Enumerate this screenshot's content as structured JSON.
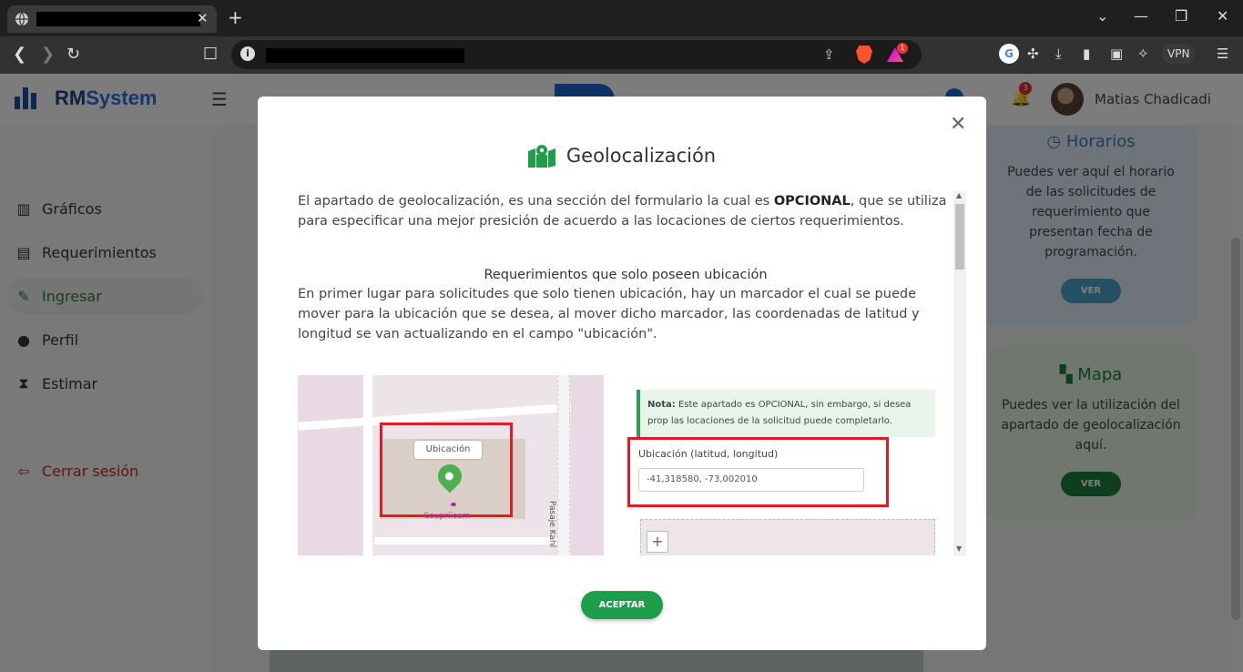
{
  "browser": {
    "tab_close": "✕",
    "new_tab": "+",
    "vpn_label": "VPN",
    "rewards_count": "1"
  },
  "app": {
    "brand_prefix": "RM",
    "brand_suffix": "System",
    "user_name": "Matias Chadicadi",
    "notifications_count": "3",
    "sidebar": [
      {
        "label": "Gráficos",
        "icon": "chart-icon"
      },
      {
        "label": "Requerimientos",
        "icon": "clipboard-icon"
      },
      {
        "label": "Ingresar",
        "icon": "pencil-icon"
      },
      {
        "label": "Perfil",
        "icon": "user-icon"
      },
      {
        "label": "Estimar",
        "icon": "hourglass-icon"
      }
    ],
    "logout_label": "Cerrar sesión",
    "cards": {
      "horarios": {
        "title": "Horarios",
        "text": "Puedes ver aquí el horario de las solicitudes de requerimiento que presentan fecha de programación.",
        "button": "VER",
        "color": "#4a9fc6"
      },
      "mapa": {
        "title": "Mapa",
        "text": "Puedes ver la utilización del apartado de geolocalización aquí.",
        "button": "VER",
        "color": "#1b7d3a"
      }
    }
  },
  "modal": {
    "title": "Geolocalización",
    "intro_before": "El apartado de geolocalización, es una sección del formulario la cual es ",
    "intro_bold": "OPCIONAL",
    "intro_after": ", que se utiliza para especificar una mejor presición de acuerdo a las locaciones de ciertos requerimientos.",
    "section_title": "Requerimientos que solo poseen ubicación",
    "section_text": "En primer lugar para solicitudes que solo tienen ubicación, hay un marcador el cual se puede mover para la ubicación que se desea, al mover dicho marcador, las coordenadas de latitud y longitud se van actualizando en el campo \"ubicación\".",
    "figure": {
      "marker_tag": "Ubicación",
      "street": "Pasaje Kahl",
      "poi": "Coupriicem",
      "note_bold": "Nota:",
      "note_text": " Este apartado es OPCIONAL, sin embargo, si desea prop las locaciones de la solicitud puede completarlo.",
      "field_label": "Ubicación (latitud, longitud)",
      "field_value": "-41,318580, -73,002010"
    },
    "accept_button": "ACEPTAR",
    "accent_color": "#1e9e4a"
  }
}
